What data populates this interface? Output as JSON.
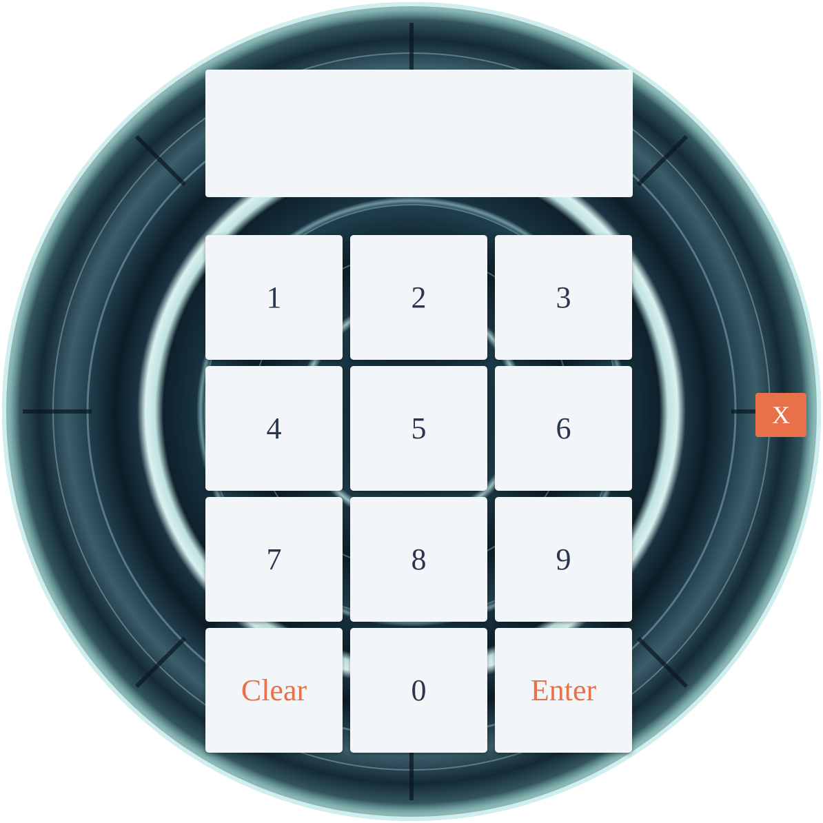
{
  "display": {
    "value": ""
  },
  "keypad": {
    "keys": [
      {
        "label": "1",
        "type": "digit"
      },
      {
        "label": "2",
        "type": "digit"
      },
      {
        "label": "3",
        "type": "digit"
      },
      {
        "label": "4",
        "type": "digit"
      },
      {
        "label": "5",
        "type": "digit"
      },
      {
        "label": "6",
        "type": "digit"
      },
      {
        "label": "7",
        "type": "digit"
      },
      {
        "label": "8",
        "type": "digit"
      },
      {
        "label": "9",
        "type": "digit"
      },
      {
        "label": "Clear",
        "type": "action"
      },
      {
        "label": "0",
        "type": "digit"
      },
      {
        "label": "Enter",
        "type": "action"
      }
    ]
  },
  "close": {
    "label": "X"
  },
  "colors": {
    "key_background": "#f2f6f9",
    "digit_text": "#2a3550",
    "accent": "#e8714a"
  },
  "icons": {
    "background": "circular-dial-image"
  }
}
